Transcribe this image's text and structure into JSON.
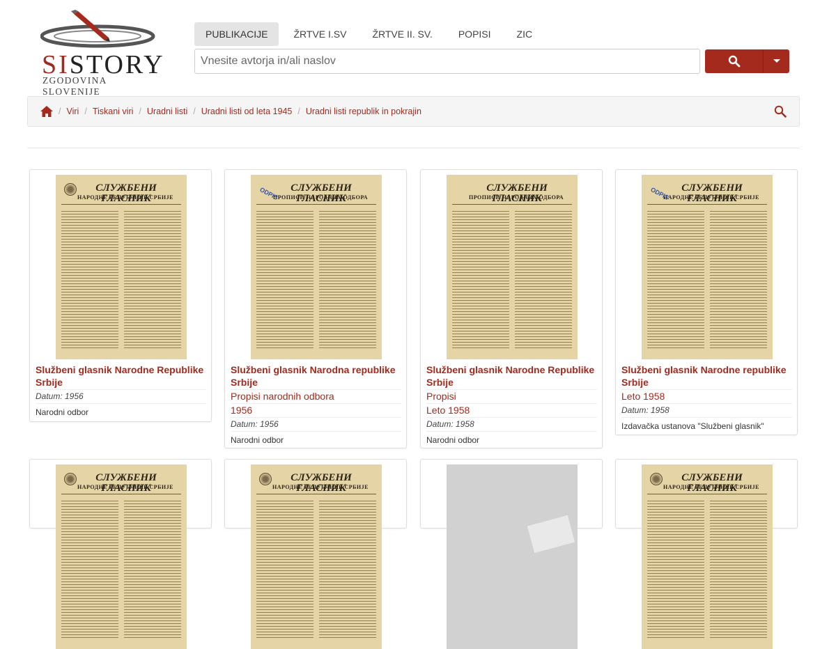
{
  "logo": {
    "brand_red": "SI",
    "brand_black": "STORY",
    "subtitle": "ZGODOVINA SLOVENIJE"
  },
  "nav": [
    {
      "label": "PUBLIKACIJE",
      "active": true
    },
    {
      "label": "ŽRTVE I.SV",
      "active": false
    },
    {
      "label": "ŽRTVE II. SV.",
      "active": false
    },
    {
      "label": "POPISI",
      "active": false
    },
    {
      "label": "ZIC",
      "active": false
    }
  ],
  "search": {
    "placeholder": "Vnesite avtorja in/ali naslov",
    "value": ""
  },
  "breadcrumb": {
    "home_icon": "home-icon",
    "items": [
      "Viri",
      "Tiskani viri",
      "Uradni listi",
      "Uradni listi od leta 1945",
      "Uradni listi republik in pokrajin"
    ]
  },
  "colors": {
    "accent": "#a32a1c",
    "paper": "#e4d4a6"
  },
  "cards": [
    {
      "title": "Službeni glasnik Narodne Republike Srbije",
      "lines": [],
      "date": "Datum: 1956",
      "publisher": "Narodni odbor",
      "masthead": "СЛУЖБЕНИ ГЛАСНИК",
      "masthead_sub": "НАРОДНЕ РЕПУБЛИКЕ СРБИЈЕ",
      "stamp": ""
    },
    {
      "title": "Službeni glasnik Narodna republike Srbije",
      "lines": [
        "Propisi narodnih odbora",
        "1956"
      ],
      "date": "Datum: 1956",
      "publisher": "Narodni odbor",
      "masthead": "СЛУЖБЕНИ ГЛАСНИК",
      "masthead_sub": "ПРОПИСИ НАРОДНИХ ОДБОРА",
      "stamp": "ODPIS"
    },
    {
      "title": "Službeni glasnik Narodne Republike Srbije",
      "lines": [
        "Propisi",
        "Leto 1958"
      ],
      "date": "Datum: 1958",
      "publisher": "Narodni odbor",
      "masthead": "СЛУЖБЕНИ ГЛАСНИК",
      "masthead_sub": "ПРОПИСИ НАРОДНИХ ОДБОРА",
      "stamp": ""
    },
    {
      "title": "Službeni glasnik Narodne republike Srbije",
      "lines": [
        "Leto 1958"
      ],
      "date": "Datum: 1958",
      "publisher": "Izdavačka ustanova \"Službeni glasnik\"",
      "masthead": "СЛУЖБЕНИ ГЛАСНИК",
      "masthead_sub": "НАРОДНЕ РЕПУБЛИКЕ СРБИЈЕ",
      "stamp": "ODPIS"
    },
    {
      "masthead": "СЛУЖБЕНИ ГЛАСНИК",
      "masthead_sub": "НАРОДНЕ РЕПУБЛИКЕ СРБИЈЕ",
      "stamp": ""
    },
    {
      "masthead": "СЛУЖБЕНИ ГЛАСНИК",
      "masthead_sub": "НАРОДНЕ РЕПУБЛИКЕ СРБИЈЕ",
      "stamp": ""
    },
    {
      "masthead": "",
      "masthead_sub": "",
      "stamp": ""
    },
    {
      "masthead": "СЛУЖБЕНИ ГЛАСНИК",
      "masthead_sub": "НАРОДНЕ РЕПУБЛИКЕ СРБИЈЕ",
      "stamp": ""
    }
  ]
}
